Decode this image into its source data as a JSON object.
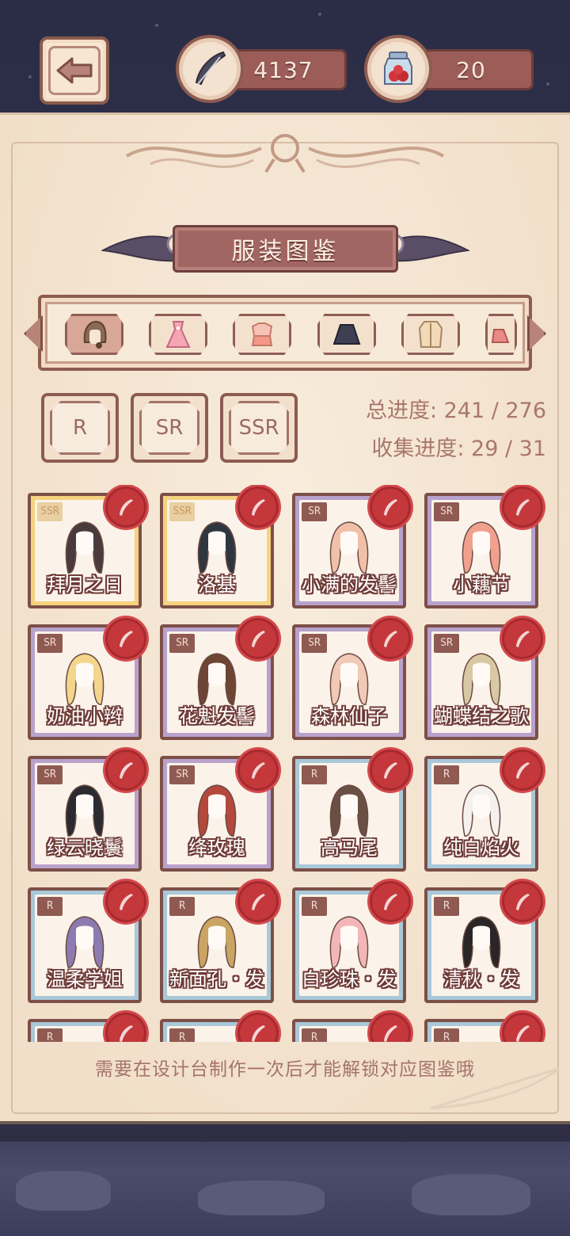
{
  "header": {
    "feather_count": "4137",
    "potion_count": "20"
  },
  "title": "服装图鉴",
  "categories": [
    {
      "icon": "hair-icon",
      "active": true
    },
    {
      "icon": "dress-icon",
      "active": false
    },
    {
      "icon": "top-icon",
      "active": false
    },
    {
      "icon": "skirt-icon",
      "active": false
    },
    {
      "icon": "coat-icon",
      "active": false
    },
    {
      "icon": "shoe-icon",
      "active": false
    }
  ],
  "rarity_filters": [
    "R",
    "SR",
    "SSR"
  ],
  "progress": {
    "total": "总进度: 241 / 276",
    "collect": "收集进度: 29 / 31"
  },
  "items": [
    {
      "name": "拜月之日",
      "rarity": "SSR",
      "hair": "#4a3a3e"
    },
    {
      "name": "洛基",
      "rarity": "SSR",
      "hair": "#2f3640"
    },
    {
      "name": "小满的发髻",
      "rarity": "SR",
      "hair": "#f0c0a8"
    },
    {
      "name": "小藕节",
      "rarity": "SR",
      "hair": "#f2a08e"
    },
    {
      "name": "奶油小辫",
      "rarity": "SR",
      "hair": "#f3d58c"
    },
    {
      "name": "花魁发髻",
      "rarity": "SR",
      "hair": "#6e4434"
    },
    {
      "name": "森林仙子",
      "rarity": "SR",
      "hair": "#f1c9b6"
    },
    {
      "name": "蝴蝶结之歌",
      "rarity": "SR",
      "hair": "#d8c8a4"
    },
    {
      "name": "绿云晓鬟",
      "rarity": "SR",
      "hair": "#2b2a30"
    },
    {
      "name": "绛玫瑰",
      "rarity": "SR",
      "hair": "#b4483c"
    },
    {
      "name": "高马尾",
      "rarity": "R",
      "hair": "#6a4f44"
    },
    {
      "name": "纯白焰火",
      "rarity": "R",
      "hair": "#f4f1ee"
    },
    {
      "name": "温柔学姐",
      "rarity": "R",
      "hair": "#8c7bb0"
    },
    {
      "name": "新面孔・发",
      "rarity": "R",
      "hair": "#c9a463"
    },
    {
      "name": "白珍珠・发",
      "rarity": "R",
      "hair": "#f3b6b8"
    },
    {
      "name": "清秋・发",
      "rarity": "R",
      "hair": "#2a2526"
    },
    {
      "name": "",
      "rarity": "R",
      "hair": "#ffffff"
    },
    {
      "name": "",
      "rarity": "R",
      "hair": "#ffffff"
    },
    {
      "name": "",
      "rarity": "R",
      "hair": "#ffffff"
    },
    {
      "name": "",
      "rarity": "R",
      "hair": "#ffffff"
    }
  ],
  "hint": "需要在设计台制作一次后才能解锁对应图鉴哦"
}
